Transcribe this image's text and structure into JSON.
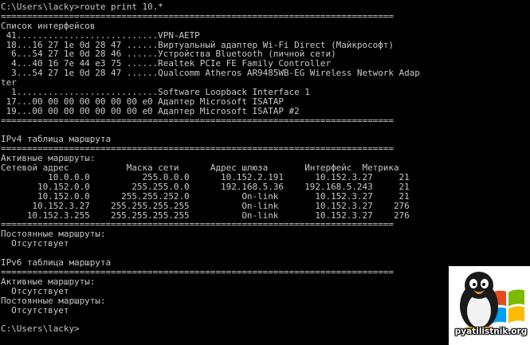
{
  "terminal": {
    "lines": [
      "C:\\Users\\lacky>route print 10.*",
      "===========================================================================",
      "Список интерфейсов",
      " 41...........................VPN-AETP",
      " 18...16 27 1e 0d 28 47 ......Виртуальный адаптер Wi-Fi Direct (Майкрософт)",
      "  6...54 27 1e 0d 28 46 ......Устройства Bluetooth (личной сети)",
      "  4...40 16 7e 44 e3 75 ......Realtek PCIe FE Family Controller",
      "  3...54 27 1e 0d 28 47 ......Qualcomm Atheros AR9485WB-EG Wireless Network Adap",
      "ter",
      "  1...........................Software Loopback Interface 1",
      " 17...00 00 00 00 00 00 00 e0 Адаптер Microsoft ISATAP",
      " 19...00 00 00 00 00 00 00 e0 Адаптер Microsoft ISATAP #2",
      "===========================================================================",
      "",
      "IPv4 таблица маршрута",
      "===========================================================================",
      "Активные маршруты:",
      "Сетевой адрес           Маска сети      Адрес шлюза       Интерфейс  Метрика",
      "         10.0.0.0          255.0.0.0      10.152.2.191      10.152.3.27     21",
      "       10.152.0.0        255.255.0.0      192.168.5.36    192.168.5.243     21",
      "       10.152.0.0      255.255.252.0          On-link       10.152.3.27     21",
      "      10.152.3.27    255.255.255.255          On-link       10.152.3.27    276",
      "     10.152.3.255    255.255.255.255          On-link       10.152.3.27    276",
      "===========================================================================",
      "Постоянные маршруты:",
      "  Отсутствует",
      "",
      "IPv6 таблица маршрута",
      "===========================================================================",
      "Активные маршруты:",
      "  Отсутствует",
      "Постоянные маршруты:",
      "  Отсутствует",
      "",
      "C:\\Users\\lacky>"
    ]
  },
  "logo": {
    "text": "pyatilistnik.org",
    "icon": "penguin-windows-logo"
  },
  "colors": {
    "background": "#000000",
    "foreground": "#c8c8c8"
  }
}
